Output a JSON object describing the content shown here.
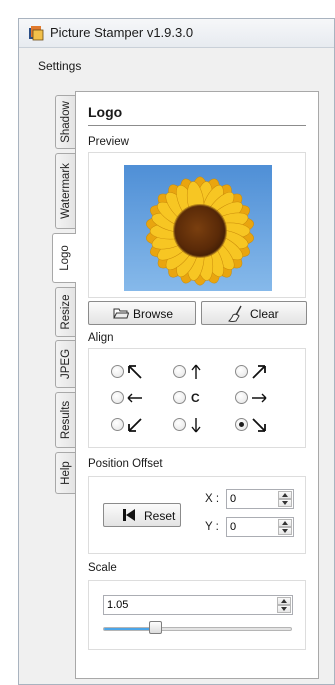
{
  "window": {
    "title": "Picture Stamper v1.9.3.0"
  },
  "menu": {
    "settings": "Settings"
  },
  "tabs": [
    {
      "label": "Shadow"
    },
    {
      "label": "Watermark"
    },
    {
      "label": "Logo"
    },
    {
      "label": "Resize"
    },
    {
      "label": "JPEG"
    },
    {
      "label": "Results"
    },
    {
      "label": "Help"
    }
  ],
  "active_tab": "Logo",
  "logo": {
    "heading": "Logo",
    "preview_label": "Preview",
    "browse_label": "Browse",
    "clear_label": "Clear",
    "align_label": "Align",
    "align_options": [
      "top-left",
      "top",
      "top-right",
      "left",
      "center",
      "right",
      "bottom-left",
      "bottom",
      "bottom-right"
    ],
    "align_center_text": "C",
    "align_selected": "bottom-right",
    "offset_label": "Position Offset",
    "reset_label": "Reset",
    "x_label": "X :",
    "y_label": "Y :",
    "x_value": "0",
    "y_value": "0",
    "scale_label": "Scale",
    "scale_value": "1.05",
    "scale_slider_fraction": 0.28
  },
  "colors": {
    "accent": "#4ba5e8"
  }
}
